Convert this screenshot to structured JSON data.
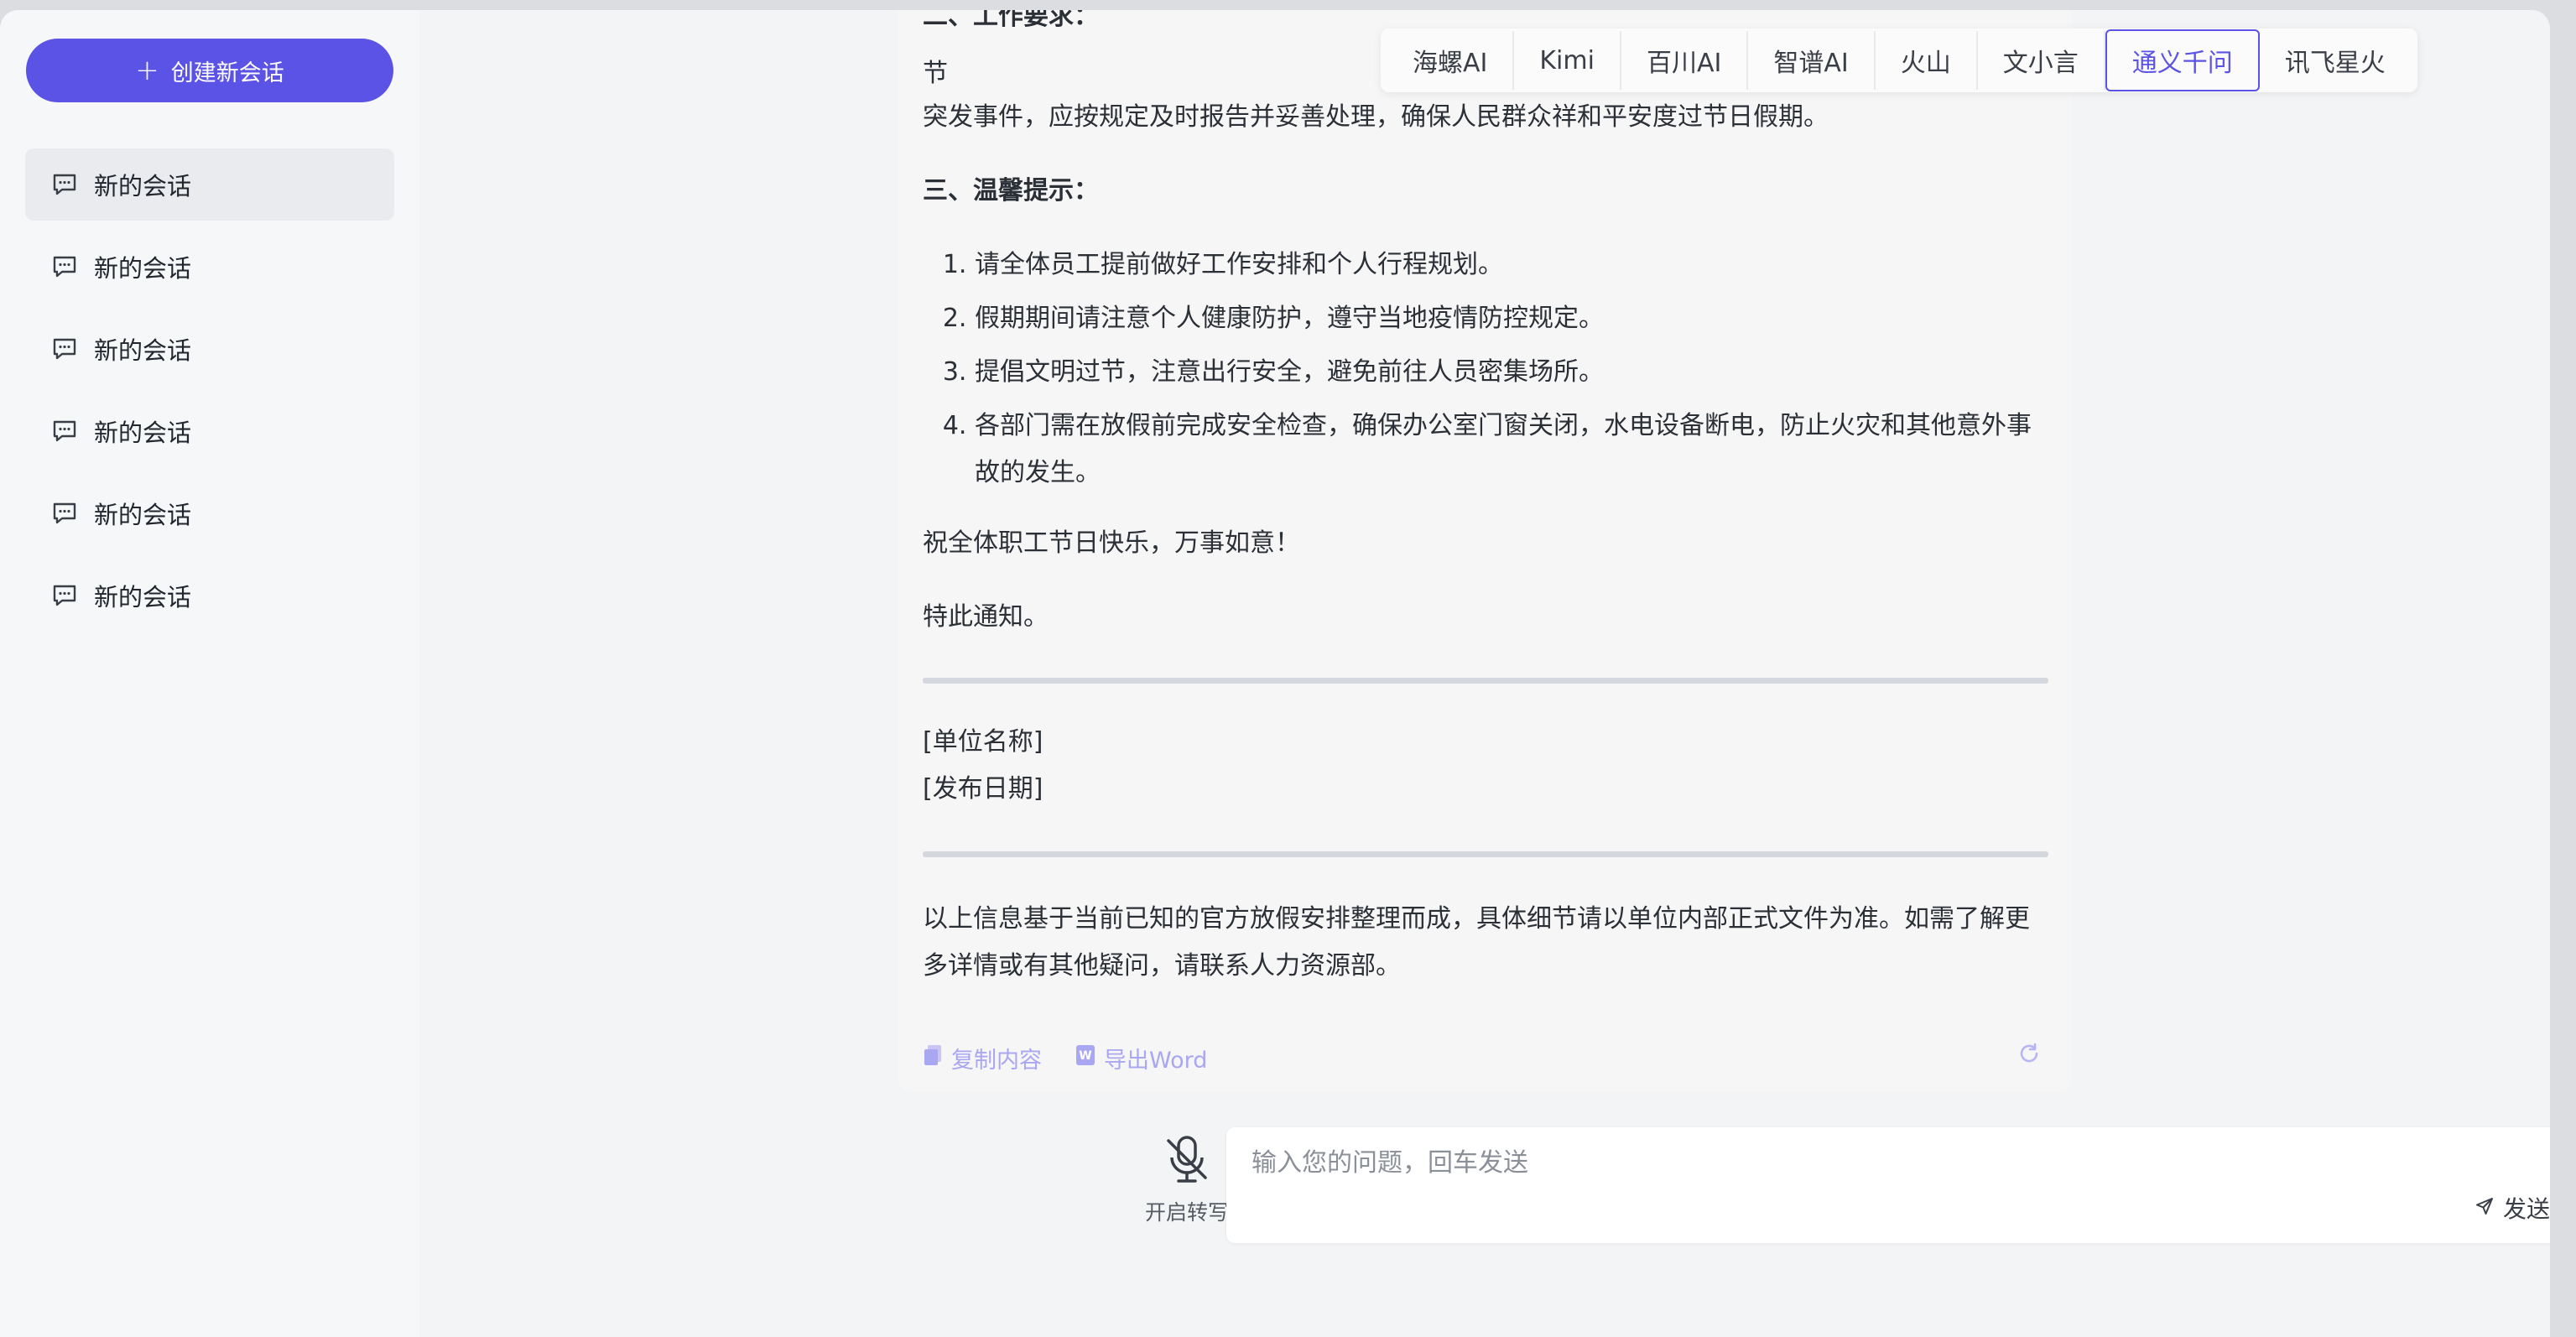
{
  "sidebar": {
    "new_chat_label": "创建新会话",
    "conversations": [
      "新的会话",
      "新的会话",
      "新的会话",
      "新的会话",
      "新的会话",
      "新的会话"
    ]
  },
  "model_tabs": {
    "items": [
      "海螺AI",
      "Kimi",
      "百川AI",
      "智谱AI",
      "火山",
      "文小言",
      "通义千问",
      "讯飞星火"
    ],
    "active": "通义千问"
  },
  "message": {
    "partial_heading": "二、工作要求：",
    "partial_line_start": "节",
    "partial_line_end": "突发事件，应按规定及时报告并妥善处理，确保人民群众祥和平安度过节日假期。",
    "section3_heading": "三、温馨提示：",
    "tips": [
      "请全体员工提前做好工作安排和个人行程规划。",
      "假期期间请注意个人健康防护，遵守当地疫情防控规定。",
      "提倡文明过节，注意出行安全，避免前往人员密集场所。",
      "各部门需在放假前完成安全检查，确保办公室门窗关闭，水电设备断电，防止火灾和其他意外事故的发生。"
    ],
    "greeting": "祝全体职工节日快乐，万事如意！",
    "notice": "特此通知。",
    "org_name": "[单位名称]",
    "publish_date": "[发布日期]",
    "footer_note": "以上信息基于当前已知的官方放假安排整理而成，具体细节请以单位内部正式文件为准。如需了解更多详情或有其他疑问，请联系人力资源部。"
  },
  "actions": {
    "copy_label": "复制内容",
    "export_label": "导出Word"
  },
  "input": {
    "placeholder": "输入您的问题，回车发送",
    "send_label": "发送",
    "mic_label": "开启转写"
  },
  "colors": {
    "accent": "#5b52e6",
    "action_muted": "#a9a6f2"
  }
}
